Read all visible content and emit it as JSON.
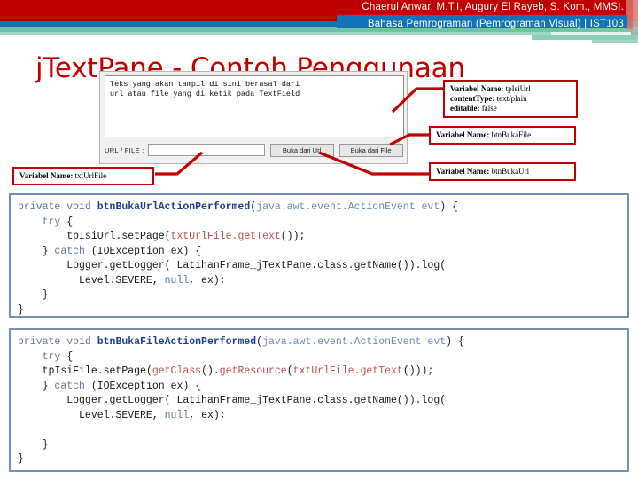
{
  "banner": {
    "authors": "Chaerul Anwar, M.T.I, Augury El Rayeb, S. Kom., MMSI.",
    "course": "Bahasa Pemrograman (Pemrograman Visual) | IST103"
  },
  "title": "jTextPane - Contoh Penggunaan",
  "gui_form": {
    "textpane_content": "Teks yang akan tampil di sini berasal dari\nurl atau file yang di ketik pada TextField",
    "url_file_label": "URL / FILE :",
    "url_file_value": "",
    "url_file_placeholder": "",
    "buttons": {
      "buka_url": "Buka dari Url",
      "buka_file": "Buka dari File"
    }
  },
  "callouts": {
    "tp_isi_url": {
      "line1_key": "Variabel Name:",
      "line1_val": " tpIsiUrl",
      "line2_key": "contentType:",
      "line2_val": " text/plain",
      "line3_key": "editable:",
      "line3_val": " false"
    },
    "btn_buka_file": {
      "key": "Variabel Name:",
      "val": " btnBukaFile"
    },
    "btn_buka_url": {
      "key": "Variabel Name:",
      "val": " btnBukaUrl"
    },
    "txt_url_file": {
      "key": "Variabel Name:",
      "val": " txtUrlFile"
    }
  },
  "code_blocks": [
    {
      "id": "btnBukaUrlActionPerformed",
      "lines": [
        "private void btnBukaUrlActionPerformed(java.awt.event.ActionEvent evt) {",
        "    try {",
        "        tpIsiUrl.setPage(txtUrlFile.getText());",
        "    } catch (IOException ex) {",
        "        Logger.getLogger( LatihanFrame_jTextPane.class.getName()).log(",
        "          Level.SEVERE, null, ex);",
        "    }",
        "}"
      ]
    },
    {
      "id": "btnBukaFileActionPerformed",
      "lines": [
        "private void btnBukaFileActionPerformed(java.awt.event.ActionEvent evt) {",
        "    try {",
        "    tpIsiFile.setPage(getClass().getResource(txtUrlFile.getText()));",
        "    } catch (IOException ex) {",
        "        Logger.getLogger( LatihanFrame_jTextPane.class.getName()).log(",
        "          Level.SEVERE, null, ex);",
        "",
        "    }",
        "}"
      ]
    }
  ],
  "colors": {
    "banner_red": "#c00000",
    "banner_blue": "#1273b8",
    "banner_teal": "#6fc2a6",
    "title_red": "#c00000",
    "callout_border": "#c00000",
    "code_border": "#7390b5",
    "code_keyword": "#5f7a99",
    "code_method": "#1f3f8c",
    "code_string": "#c0504d"
  }
}
